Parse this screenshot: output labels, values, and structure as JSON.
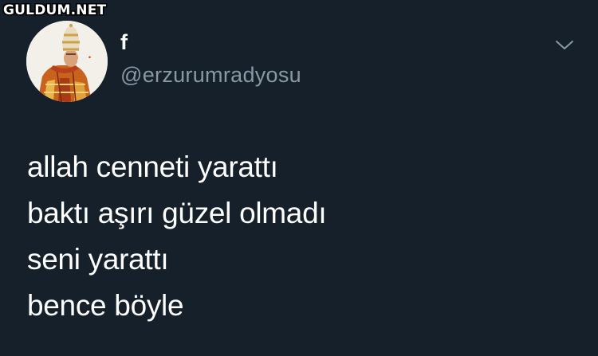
{
  "watermark": {
    "text": "GULDUM.NET"
  },
  "tweet": {
    "author": {
      "display_name": "f",
      "handle": "@erzurumradyosu",
      "avatar_icon": "avatar-pope-illustration"
    },
    "menu_icon": "chevron-down-icon",
    "lines": [
      "allah cenneti yarattı",
      "baktı aşırı güzel olmadı",
      "seni yarattı",
      "bence böyle"
    ]
  },
  "colors": {
    "background": "#15202b",
    "text_primary": "#ffffff",
    "text_secondary": "#8899a6"
  }
}
